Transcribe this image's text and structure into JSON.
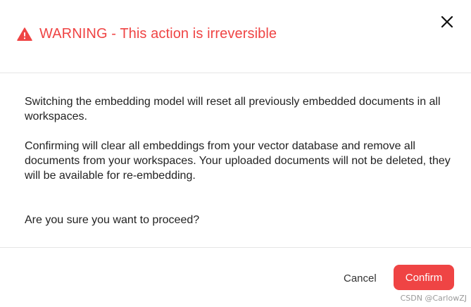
{
  "dialog": {
    "title": "WARNING - This action is irreversible",
    "close_icon": "close-icon",
    "warning_icon": "warning-triangle-icon"
  },
  "body": {
    "paragraph_1": "Switching the embedding model will reset all previously embedded documents in all workspaces.",
    "paragraph_2": "Confirming will clear all embeddings from your vector database and remove all documents from your workspaces. Your uploaded documents will not be deleted, they will be available for re-embedding.",
    "paragraph_3": "Are you sure you want to proceed?"
  },
  "footer": {
    "cancel_label": "Cancel",
    "confirm_label": "Confirm"
  },
  "watermark": "CSDN @CarlowZJ",
  "colors": {
    "danger": "#ef4444",
    "text": "#222222",
    "divider": "#e5e5e5"
  }
}
